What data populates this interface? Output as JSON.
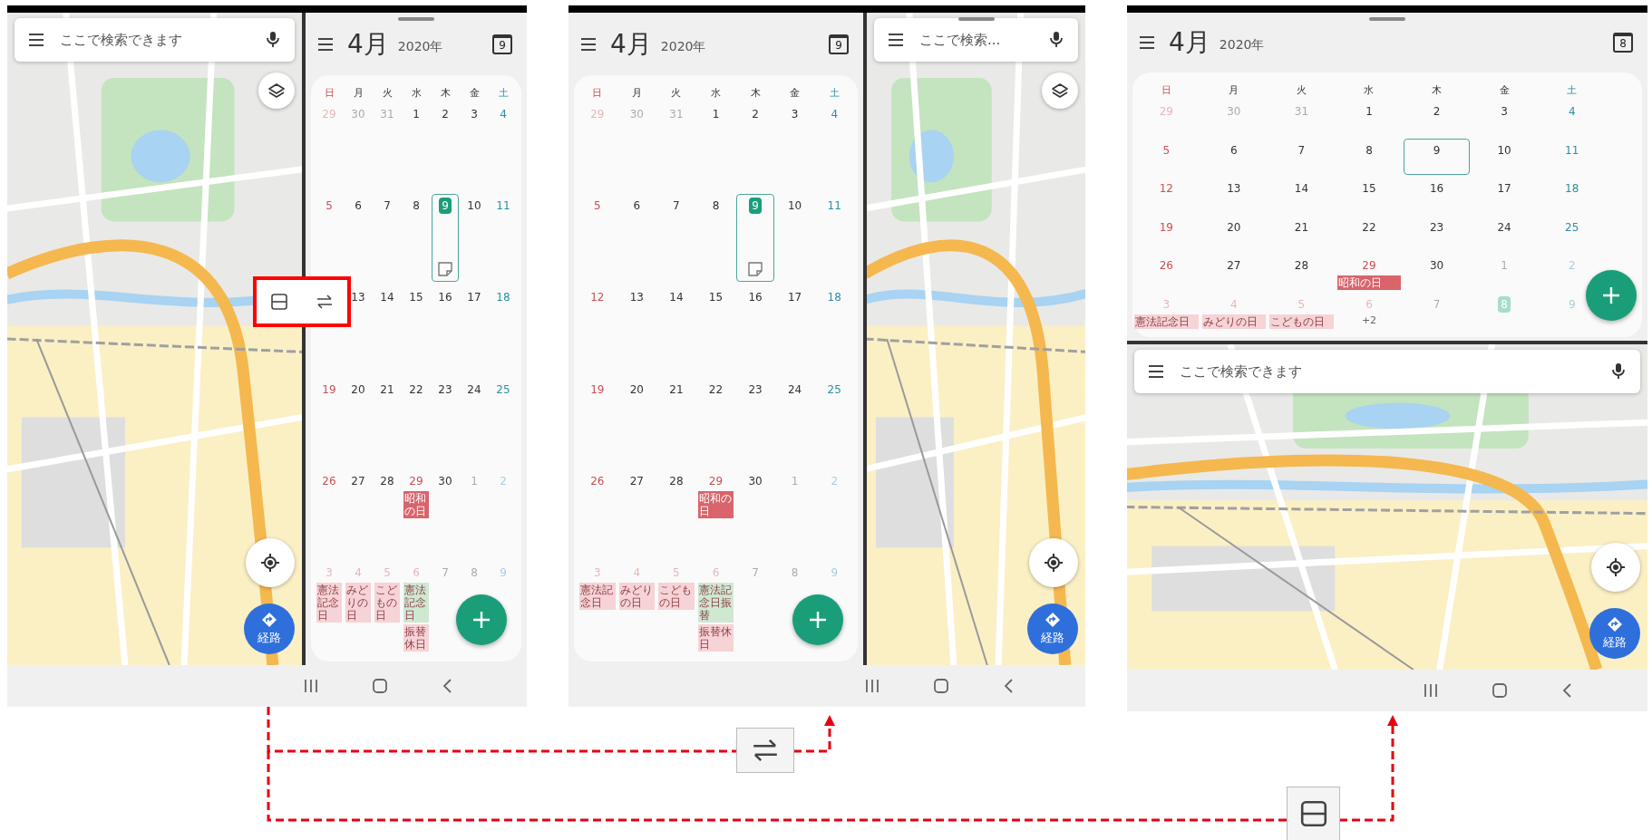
{
  "phones": [
    {
      "kind": "side_by_side",
      "split_menu_open": true,
      "panes": [
        {
          "kind": "map",
          "placeholder": "ここで検索できます",
          "layers_button": true,
          "directions_label": "経路"
        },
        {
          "kind": "calendar",
          "has_handle": true,
          "month": "4月",
          "year": "2020年",
          "today_number": "9",
          "weekdays": [
            {
              "label": "日",
              "kind": "sunday"
            },
            {
              "label": "月",
              "kind": "weekday"
            },
            {
              "label": "火",
              "kind": "weekday"
            },
            {
              "label": "水",
              "kind": "weekday"
            },
            {
              "label": "木",
              "kind": "weekday"
            },
            {
              "label": "金",
              "kind": "weekday"
            },
            {
              "label": "土",
              "kind": "saturday"
            }
          ],
          "weeks": [
            [
              {
                "label": "29",
                "outside": true,
                "today": false,
                "selected": false
              },
              {
                "label": "30",
                "outside": true,
                "today": false,
                "selected": false
              },
              {
                "label": "31",
                "outside": true,
                "today": false,
                "selected": false
              },
              {
                "label": "1",
                "outside": false,
                "today": false,
                "selected": false
              },
              {
                "label": "2",
                "outside": false,
                "today": false,
                "selected": false
              },
              {
                "label": "3",
                "outside": false,
                "today": false,
                "selected": false
              },
              {
                "label": "4",
                "outside": false,
                "today": false,
                "selected": false
              }
            ],
            [
              {
                "label": "5",
                "outside": false,
                "today": false,
                "selected": false
              },
              {
                "label": "6",
                "outside": false,
                "today": false,
                "selected": false
              },
              {
                "label": "7",
                "outside": false,
                "today": false,
                "selected": false
              },
              {
                "label": "8",
                "outside": false,
                "today": false,
                "selected": false
              },
              {
                "label": "9",
                "outside": false,
                "today": true,
                "selected": true,
                "sticker": true
              },
              {
                "label": "10",
                "outside": false,
                "today": false,
                "selected": false
              },
              {
                "label": "11",
                "outside": false,
                "today": false,
                "selected": false
              }
            ],
            [
              {
                "label": "13",
                "outside": false,
                "today": false,
                "selected": false
              },
              {
                "label": "14",
                "outside": false,
                "today": false,
                "selected": false
              },
              {
                "label": "15",
                "outside": false,
                "today": false,
                "selected": false
              },
              {
                "label": "16",
                "outside": false,
                "today": false,
                "selected": false
              },
              {
                "label": "17",
                "outside": false,
                "today": false,
                "selected": false
              },
              {
                "label": "18",
                "outside": false,
                "today": false,
                "selected": false
              }
            ],
            [
              {
                "label": "19",
                "outside": false,
                "today": false,
                "selected": false
              },
              {
                "label": "20",
                "outside": false,
                "today": false,
                "selected": false
              },
              {
                "label": "21",
                "outside": false,
                "today": false,
                "selected": false
              },
              {
                "label": "22",
                "outside": false,
                "today": false,
                "selected": false
              },
              {
                "label": "23",
                "outside": false,
                "today": false,
                "selected": false
              },
              {
                "label": "24",
                "outside": false,
                "today": false,
                "selected": false
              },
              {
                "label": "25",
                "outside": false,
                "today": false,
                "selected": false
              }
            ],
            [
              {
                "label": "26",
                "outside": false,
                "today": false,
                "selected": false
              },
              {
                "label": "27",
                "outside": false,
                "today": false,
                "selected": false
              },
              {
                "label": "28",
                "outside": false,
                "today": false,
                "selected": false
              },
              {
                "label": "29",
                "outside": false,
                "holiday": true,
                "today": false,
                "selected": false,
                "events": [
                  {
                    "text": "昭和の日",
                    "color": "#d9646b"
                  }
                ]
              },
              {
                "label": "30",
                "outside": false,
                "today": false,
                "selected": false
              },
              {
                "label": "1",
                "outside": true,
                "today": false,
                "selected": false
              },
              {
                "label": "2",
                "outside": true,
                "today": false,
                "selected": false
              }
            ],
            [
              {
                "label": "3",
                "outside": true,
                "today": false,
                "selected": false,
                "events": [
                  {
                    "text": "憲法記念日",
                    "color": "#f6d3d6"
                  }
                ]
              },
              {
                "label": "4",
                "outside": true,
                "holiday": true,
                "today": false,
                "selected": false,
                "events": [
                  {
                    "text": "みどりの日",
                    "color": "#f6d3d6"
                  }
                ]
              },
              {
                "label": "5",
                "outside": true,
                "holiday": true,
                "today": false,
                "selected": false,
                "events": [
                  {
                    "text": "こどもの日",
                    "color": "#f6d3d6"
                  }
                ]
              },
              {
                "label": "6",
                "outside": true,
                "holiday": true,
                "today": false,
                "selected": false,
                "events": [
                  {
                    "text": "憲法記念日",
                    "color": "#cfe8d2"
                  },
                  {
                    "text": "振替休日",
                    "color": "#f6d3d6"
                  }
                ]
              },
              {
                "label": "7",
                "outside": true,
                "today": false,
                "selected": false
              },
              {
                "label": "8",
                "outside": true,
                "today": false,
                "selected": false
              },
              {
                "label": "9",
                "outside": true,
                "today": false,
                "selected": false
              }
            ]
          ]
        }
      ]
    },
    {
      "kind": "side_by_side",
      "panes": [
        {
          "kind": "calendar",
          "month": "4月",
          "year": "2020年",
          "today_number": "9",
          "weekdays": [
            {
              "label": "日",
              "kind": "sunday"
            },
            {
              "label": "月",
              "kind": "weekday"
            },
            {
              "label": "火",
              "kind": "weekday"
            },
            {
              "label": "水",
              "kind": "weekday"
            },
            {
              "label": "木",
              "kind": "weekday"
            },
            {
              "label": "金",
              "kind": "weekday"
            },
            {
              "label": "土",
              "kind": "saturday"
            }
          ],
          "weeks": [
            [
              {
                "label": "29",
                "outside": true,
                "today": false,
                "selected": false
              },
              {
                "label": "30",
                "outside": true,
                "today": false,
                "selected": false
              },
              {
                "label": "31",
                "outside": true,
                "today": false,
                "selected": false
              },
              {
                "label": "1",
                "outside": false,
                "today": false,
                "selected": false
              },
              {
                "label": "2",
                "outside": false,
                "today": false,
                "selected": false
              },
              {
                "label": "3",
                "outside": false,
                "today": false,
                "selected": false
              },
              {
                "label": "4",
                "outside": false,
                "today": false,
                "selected": false
              }
            ],
            [
              {
                "label": "5",
                "outside": false,
                "today": false,
                "selected": false
              },
              {
                "label": "6",
                "outside": false,
                "today": false,
                "selected": false
              },
              {
                "label": "7",
                "outside": false,
                "today": false,
                "selected": false
              },
              {
                "label": "8",
                "outside": false,
                "today": false,
                "selected": false
              },
              {
                "label": "9",
                "outside": false,
                "today": true,
                "selected": true,
                "sticker": true
              },
              {
                "label": "10",
                "outside": false,
                "today": false,
                "selected": false
              },
              {
                "label": "11",
                "outside": false,
                "today": false,
                "selected": false
              }
            ],
            [
              {
                "label": "12",
                "outside": false,
                "today": false,
                "selected": false
              },
              {
                "label": "13",
                "outside": false,
                "today": false,
                "selected": false
              },
              {
                "label": "14",
                "outside": false,
                "today": false,
                "selected": false
              },
              {
                "label": "15",
                "outside": false,
                "today": false,
                "selected": false
              },
              {
                "label": "16",
                "outside": false,
                "today": false,
                "selected": false
              },
              {
                "label": "17",
                "outside": false,
                "today": false,
                "selected": false
              },
              {
                "label": "18",
                "outside": false,
                "today": false,
                "selected": false
              }
            ],
            [
              {
                "label": "19",
                "outside": false,
                "today": false,
                "selected": false
              },
              {
                "label": "20",
                "outside": false,
                "today": false,
                "selected": false
              },
              {
                "label": "21",
                "outside": false,
                "today": false,
                "selected": false
              },
              {
                "label": "22",
                "outside": false,
                "today": false,
                "selected": false
              },
              {
                "label": "23",
                "outside": false,
                "today": false,
                "selected": false
              },
              {
                "label": "24",
                "outside": false,
                "today": false,
                "selected": false
              },
              {
                "label": "25",
                "outside": false,
                "today": false,
                "selected": false
              }
            ],
            [
              {
                "label": "26",
                "outside": false,
                "today": false,
                "selected": false
              },
              {
                "label": "27",
                "outside": false,
                "today": false,
                "selected": false
              },
              {
                "label": "28",
                "outside": false,
                "today": false,
                "selected": false
              },
              {
                "label": "29",
                "outside": false,
                "holiday": true,
                "today": false,
                "selected": false,
                "events": [
                  {
                    "text": "昭和の日",
                    "color": "#d9646b"
                  }
                ]
              },
              {
                "label": "30",
                "outside": false,
                "today": false,
                "selected": false
              },
              {
                "label": "1",
                "outside": true,
                "today": false,
                "selected": false
              },
              {
                "label": "2",
                "outside": true,
                "today": false,
                "selected": false
              }
            ],
            [
              {
                "label": "3",
                "outside": true,
                "today": false,
                "selected": false,
                "events": [
                  {
                    "text": "憲法記念日",
                    "color": "#f6d3d6"
                  }
                ]
              },
              {
                "label": "4",
                "outside": true,
                "holiday": true,
                "today": false,
                "selected": false,
                "events": [
                  {
                    "text": "みどりの日",
                    "color": "#f6d3d6"
                  }
                ]
              },
              {
                "label": "5",
                "outside": true,
                "holiday": true,
                "today": false,
                "selected": false,
                "events": [
                  {
                    "text": "こどもの日",
                    "color": "#f6d3d6"
                  }
                ]
              },
              {
                "label": "6",
                "outside": true,
                "holiday": true,
                "today": false,
                "selected": false,
                "events": [
                  {
                    "text": "憲法記念日振替",
                    "color": "#cfe8d2"
                  },
                  {
                    "text": "振替休日",
                    "color": "#f6d3d6"
                  }
                ]
              },
              {
                "label": "7",
                "outside": true,
                "today": false,
                "selected": false
              },
              {
                "label": "8",
                "outside": true,
                "today": false,
                "selected": false
              },
              {
                "label": "9",
                "outside": true,
                "today": false,
                "selected": false
              }
            ]
          ]
        },
        {
          "kind": "map",
          "has_handle": true,
          "placeholder": "ここで検索...",
          "layers_button": true,
          "directions_label": "経路"
        }
      ]
    },
    {
      "kind": "stacked",
      "panes": [
        {
          "kind": "calendar",
          "has_handle": true,
          "month": "4月",
          "year": "2020年",
          "today_number": "8",
          "weekdays": [
            {
              "label": "日",
              "kind": "sunday"
            },
            {
              "label": "月",
              "kind": "weekday"
            },
            {
              "label": "火",
              "kind": "weekday"
            },
            {
              "label": "水",
              "kind": "weekday"
            },
            {
              "label": "木",
              "kind": "weekday"
            },
            {
              "label": "金",
              "kind": "weekday"
            },
            {
              "label": "土",
              "kind": "saturday"
            }
          ],
          "weeks": [
            [
              {
                "label": "29",
                "outside": true,
                "today": false,
                "selected": false
              },
              {
                "label": "30",
                "outside": true,
                "today": false,
                "selected": false
              },
              {
                "label": "31",
                "outside": true,
                "today": false,
                "selected": false
              },
              {
                "label": "1",
                "outside": false,
                "today": false,
                "selected": false
              },
              {
                "label": "2",
                "outside": false,
                "today": false,
                "selected": false
              },
              {
                "label": "3",
                "outside": false,
                "today": false,
                "selected": false
              },
              {
                "label": "4",
                "outside": false,
                "today": false,
                "selected": false
              }
            ],
            [
              {
                "label": "5",
                "outside": false,
                "today": false,
                "selected": false
              },
              {
                "label": "6",
                "outside": false,
                "today": false,
                "selected": false
              },
              {
                "label": "7",
                "outside": false,
                "today": false,
                "selected": false
              },
              {
                "label": "8",
                "outside": false,
                "today": false,
                "selected": false
              },
              {
                "label": "9",
                "outside": false,
                "today": false,
                "selected": true
              },
              {
                "label": "10",
                "outside": false,
                "today": false,
                "selected": false
              },
              {
                "label": "11",
                "outside": false,
                "today": false,
                "selected": false
              }
            ],
            [
              {
                "label": "12",
                "outside": false,
                "today": false,
                "selected": false
              },
              {
                "label": "13",
                "outside": false,
                "today": false,
                "selected": false
              },
              {
                "label": "14",
                "outside": false,
                "today": false,
                "selected": false
              },
              {
                "label": "15",
                "outside": false,
                "today": false,
                "selected": false
              },
              {
                "label": "16",
                "outside": false,
                "today": false,
                "selected": false
              },
              {
                "label": "17",
                "outside": false,
                "today": false,
                "selected": false
              },
              {
                "label": "18",
                "outside": false,
                "today": false,
                "selected": false
              }
            ],
            [
              {
                "label": "19",
                "outside": false,
                "today": false,
                "selected": false
              },
              {
                "label": "20",
                "outside": false,
                "today": false,
                "selected": false
              },
              {
                "label": "21",
                "outside": false,
                "today": false,
                "selected": false
              },
              {
                "label": "22",
                "outside": false,
                "today": false,
                "selected": false
              },
              {
                "label": "23",
                "outside": false,
                "today": false,
                "selected": false
              },
              {
                "label": "24",
                "outside": false,
                "today": false,
                "selected": false
              },
              {
                "label": "25",
                "outside": false,
                "today": false,
                "selected": false
              }
            ],
            [
              {
                "label": "26",
                "outside": false,
                "today": false,
                "selected": false
              },
              {
                "label": "27",
                "outside": false,
                "today": false,
                "selected": false
              },
              {
                "label": "28",
                "outside": false,
                "today": false,
                "selected": false
              },
              {
                "label": "29",
                "outside": false,
                "holiday": true,
                "today": false,
                "selected": false,
                "events": [
                  {
                    "text": "昭和の日",
                    "color": "#d9646b"
                  }
                ]
              },
              {
                "label": "30",
                "outside": false,
                "today": false,
                "selected": false
              },
              {
                "label": "1",
                "outside": true,
                "today": false,
                "selected": false
              },
              {
                "label": "2",
                "outside": true,
                "today": false,
                "selected": false
              }
            ],
            [
              {
                "label": "3",
                "outside": true,
                "today": false,
                "selected": false,
                "events": [
                  {
                    "text": "憲法記念日",
                    "color": "#f6d3d6"
                  }
                ]
              },
              {
                "label": "4",
                "outside": true,
                "holiday": true,
                "today": false,
                "selected": false,
                "events": [
                  {
                    "text": "みどりの日",
                    "color": "#f6d3d6"
                  }
                ]
              },
              {
                "label": "5",
                "outside": true,
                "holiday": true,
                "today": false,
                "selected": false,
                "events": [
                  {
                    "text": "こどもの日",
                    "color": "#f6d3d6"
                  }
                ]
              },
              {
                "label": "6",
                "outside": true,
                "holiday": true,
                "today": false,
                "selected": false,
                "more": "+2"
              },
              {
                "label": "7",
                "outside": true,
                "today": false,
                "selected": false
              },
              {
                "label": "8",
                "outside": true,
                "today": true,
                "selected": false
              },
              {
                "label": "9",
                "outside": true,
                "today": false,
                "selected": false
              }
            ]
          ]
        },
        {
          "kind": "map",
          "placeholder": "ここで検索できます",
          "directions_label": "経路"
        }
      ]
    }
  ],
  "annotations": [
    {
      "kind": "swap"
    },
    {
      "kind": "split"
    }
  ]
}
